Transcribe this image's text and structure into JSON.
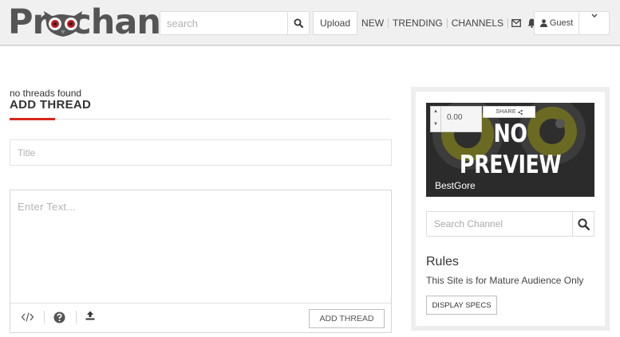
{
  "header": {
    "logo": "Prochan",
    "search_placeholder": "search",
    "upload_label": "Upload",
    "nav": [
      {
        "label": "NEW"
      },
      {
        "label": "TRENDING"
      },
      {
        "label": "CHANNELS"
      }
    ],
    "user_label": "Guest"
  },
  "main": {
    "status": "no threads found",
    "heading": "ADD THREAD",
    "title_placeholder": "Title",
    "text_placeholder": "Enter Text...",
    "submit_label": "ADD THREAD"
  },
  "sidebar": {
    "player_time": "0.00",
    "share_label": "SHARE",
    "preview_line1": "NO",
    "preview_line2": "PREVIEW",
    "channel_name": "BestGore",
    "channel_search_placeholder": "Search Channel",
    "rules_title": "Rules",
    "rules_text": "This Site is for Mature Audience Only",
    "specs_label": "DISPLAY SPECS"
  },
  "colors": {
    "accent": "#d9261c",
    "header_bg": "#f0f0f0",
    "card_bg": "#2b2b2b"
  }
}
